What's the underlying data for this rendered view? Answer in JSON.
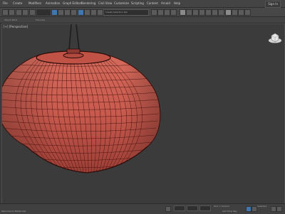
{
  "menubar": {
    "items": [
      "File",
      "Create",
      "Modifiers",
      "Animation",
      "Graph Editors",
      "Rendering",
      "Civil View",
      "Customize",
      "Scripting",
      "Content",
      "Arnold",
      "Help"
    ],
    "sign_in": "Sign In"
  },
  "toolbar": {
    "selection_set": "Create Selection Set"
  },
  "subbar": {
    "labels": [
      "Object Paint",
      "Populate"
    ]
  },
  "viewport": {
    "label": "[+] [Perspective]"
  },
  "status": {
    "welcome": "Welcome to MAXScript.",
    "add_time_tag": "Add Time Tag",
    "grid": "Grid = 10.0cm",
    "selected": "Selected"
  },
  "colors": {
    "model_fill": "#c85a4e",
    "wireframe": "#4a1510",
    "background": "#3a3a3a",
    "accent": "#3f77b0"
  }
}
